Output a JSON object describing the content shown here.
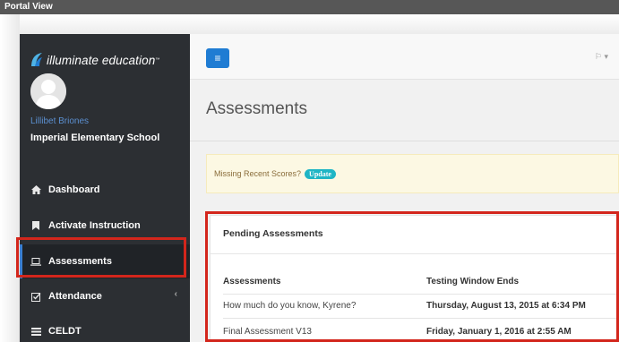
{
  "portal": {
    "title": "Portal View"
  },
  "logo": {
    "text": "illuminate education",
    "tm": "™"
  },
  "user": {
    "name": "Lillibet Briones",
    "school": "Imperial Elementary School"
  },
  "nav": [
    {
      "label": "Dashboard",
      "icon": "home-icon"
    },
    {
      "label": "Activate Instruction",
      "icon": "bookmark-icon"
    },
    {
      "label": "Assessments",
      "icon": "laptop-icon",
      "active": true
    },
    {
      "label": "Attendance",
      "icon": "check-square-icon",
      "caret": "‹"
    },
    {
      "label": "CELDT",
      "icon": "list-icon"
    }
  ],
  "topbar": {
    "menu_icon": "≡",
    "right_icon": "⚐ ▾"
  },
  "page": {
    "title": "Assessments"
  },
  "alert": {
    "text": "Missing Recent Scores?",
    "button": "Update"
  },
  "pending": {
    "title": "Pending Assessments",
    "columns": [
      "Assessments",
      "Testing Window Ends"
    ],
    "rows": [
      [
        "How much do you know, Kyrene?",
        "Thursday, August 13, 2015 at 6:34 PM"
      ],
      [
        "Final Assessment V13",
        "Friday, January 1, 2016 at 2:55 AM"
      ]
    ]
  },
  "colors": {
    "sidebar": "#2c2f33",
    "accent": "#1f7cd3",
    "highlight": "#d3261c",
    "alert_bg": "#fcf8e3"
  }
}
